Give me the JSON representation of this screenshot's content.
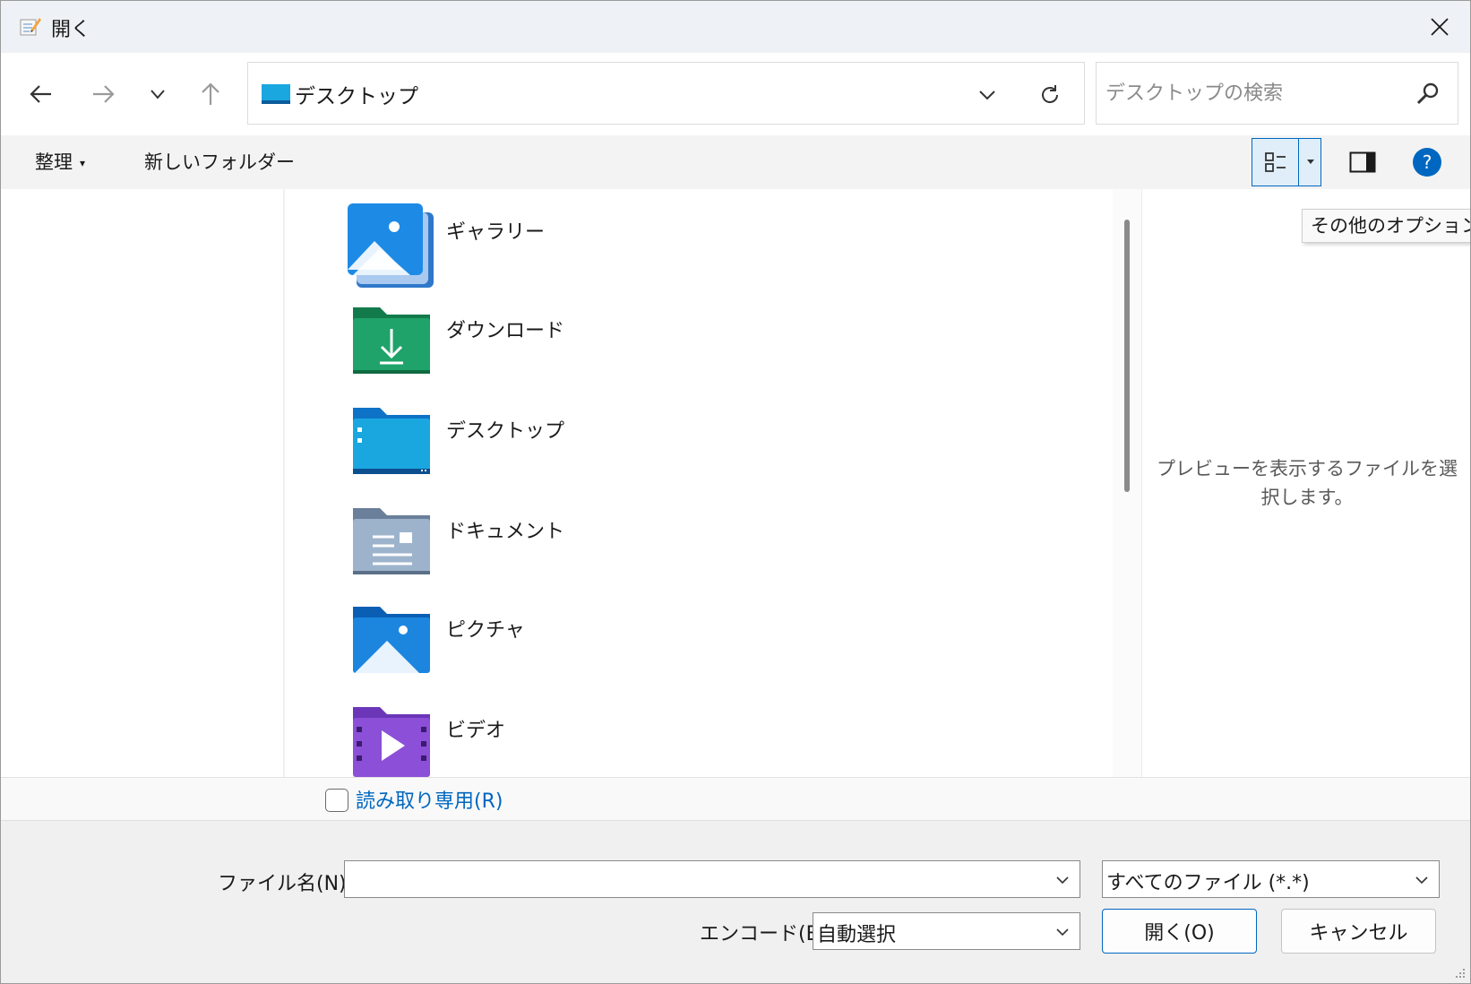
{
  "window": {
    "title": "開く",
    "close_icon": "close-icon"
  },
  "nav": {
    "back_icon": "back-arrow-icon",
    "forward_icon": "forward-arrow-icon",
    "recent_icon": "chevron-down-icon",
    "up_icon": "up-arrow-icon"
  },
  "address": {
    "path": "デスクトップ",
    "dropdown_icon": "chevron-down-icon",
    "refresh_icon": "refresh-icon"
  },
  "search": {
    "placeholder": "デスクトップの検索",
    "value": ""
  },
  "commandbar": {
    "organize_label": "整理",
    "new_folder_label": "新しいフォルダー",
    "view_icon": "details-view-icon",
    "preview_icon": "preview-pane-icon",
    "help_icon": "help-icon"
  },
  "tooltip": "その他のオプション",
  "items": [
    {
      "label": "ギャラリー",
      "icon": "gallery-icon"
    },
    {
      "label": "ダウンロード",
      "icon": "downloads-folder-icon"
    },
    {
      "label": "デスクトップ",
      "icon": "desktop-folder-icon"
    },
    {
      "label": "ドキュメント",
      "icon": "documents-folder-icon"
    },
    {
      "label": "ピクチャ",
      "icon": "pictures-folder-icon"
    },
    {
      "label": "ビデオ",
      "icon": "videos-folder-icon"
    }
  ],
  "preview": {
    "message": "プレビューを表示するファイルを選択します。"
  },
  "readonly": {
    "label": "読み取り専用(R)",
    "checked": false
  },
  "bottom": {
    "filename_label": "ファイル名(N):",
    "filename_value": "",
    "filter_value": "すべてのファイル (*.*)",
    "encoding_label": "エンコード(E):",
    "encoding_value": "自動選択",
    "open_button": "開く(O)",
    "cancel_button": "キャンセル"
  },
  "colors": {
    "accent": "#0067c0",
    "link": "#0067c0"
  }
}
